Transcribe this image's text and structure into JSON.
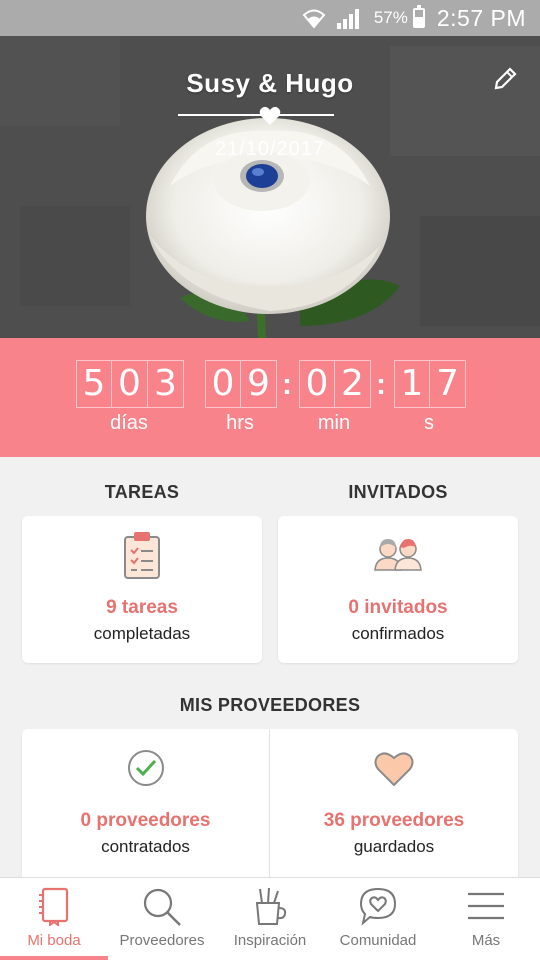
{
  "status_bar": {
    "battery": "57%",
    "time": "2:57 PM"
  },
  "header": {
    "couple": "Susy & Hugo",
    "date": "21/10/2017"
  },
  "countdown": {
    "days": [
      "5",
      "0",
      "3"
    ],
    "hours": [
      "0",
      "9"
    ],
    "minutes": [
      "0",
      "2"
    ],
    "seconds": [
      "1",
      "7"
    ],
    "labels": {
      "days": "días",
      "hours": "hrs",
      "minutes": "min",
      "seconds": "s"
    }
  },
  "tareas": {
    "title": "TAREAS",
    "count": "9 tareas",
    "sub": "completadas"
  },
  "invitados": {
    "title": "INVITADOS",
    "count": "0 invitados",
    "sub": "confirmados"
  },
  "proveedores": {
    "title": "MIS PROVEEDORES",
    "contratados": {
      "count": "0 proveedores",
      "sub": "contratados"
    },
    "guardados": {
      "count": "36 proveedores",
      "sub": "guardados"
    }
  },
  "nav": {
    "items": [
      {
        "label": "Mi boda",
        "icon": "notebook-icon"
      },
      {
        "label": "Proveedores",
        "icon": "search-icon"
      },
      {
        "label": "Inspiración",
        "icon": "pencil-cup-icon"
      },
      {
        "label": "Comunidad",
        "icon": "chat-heart-icon"
      },
      {
        "label": "Más",
        "icon": "menu-icon"
      }
    ],
    "active": "Mi boda"
  },
  "colors": {
    "accent": "#f8838b",
    "count_text": "#e8726f",
    "status_bar": "#ababab"
  }
}
